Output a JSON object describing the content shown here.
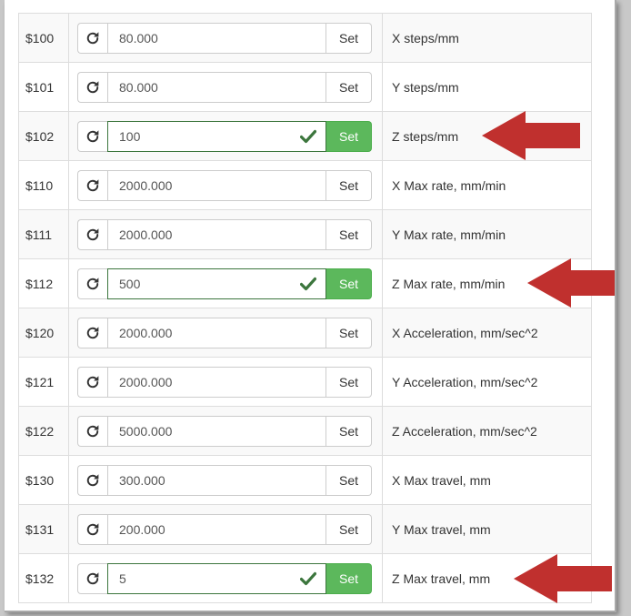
{
  "set_label": "Set",
  "colors": {
    "success": "#5cb85c",
    "arrow": "#c0302e"
  },
  "icons": {
    "reset": "refresh-icon",
    "valid": "checkmark-icon",
    "pointer": "arrow-left-icon"
  },
  "settings": [
    {
      "code": "$100",
      "value": "80.000",
      "desc": "X steps/mm",
      "changed": false
    },
    {
      "code": "$101",
      "value": "80.000",
      "desc": "Y steps/mm",
      "changed": false
    },
    {
      "code": "$102",
      "value": "100",
      "desc": "Z steps/mm",
      "changed": true
    },
    {
      "code": "$110",
      "value": "2000.000",
      "desc": "X Max rate, mm/min",
      "changed": false
    },
    {
      "code": "$111",
      "value": "2000.000",
      "desc": "Y Max rate, mm/min",
      "changed": false
    },
    {
      "code": "$112",
      "value": "500",
      "desc": "Z Max rate, mm/min",
      "changed": true
    },
    {
      "code": "$120",
      "value": "2000.000",
      "desc": "X Acceleration, mm/sec^2",
      "changed": false
    },
    {
      "code": "$121",
      "value": "2000.000",
      "desc": "Y Acceleration, mm/sec^2",
      "changed": false
    },
    {
      "code": "$122",
      "value": "5000.000",
      "desc": "Z Acceleration, mm/sec^2",
      "changed": false
    },
    {
      "code": "$130",
      "value": "300.000",
      "desc": "X Max travel, mm",
      "changed": false
    },
    {
      "code": "$131",
      "value": "200.000",
      "desc": "Y Max travel, mm",
      "changed": false
    },
    {
      "code": "$132",
      "value": "5",
      "desc": "Z Max travel, mm",
      "changed": true
    }
  ]
}
